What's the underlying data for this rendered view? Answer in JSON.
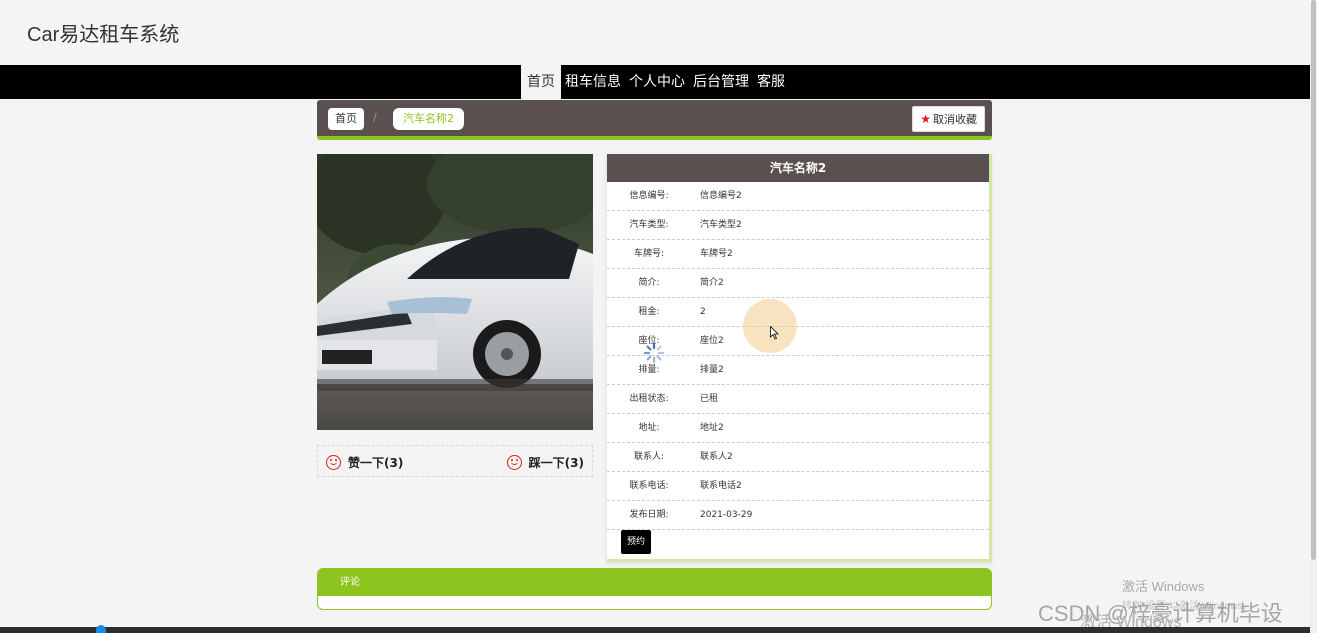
{
  "header": {
    "title": "Car易达租车系统"
  },
  "nav": {
    "items": [
      "首页",
      "租车信息",
      "个人中心",
      "后台管理",
      "客服"
    ]
  },
  "breadcrumb": {
    "home": "首页",
    "separator": "/",
    "current": "汽车名称2"
  },
  "favorite": {
    "label": "取消收藏"
  },
  "votes": {
    "like": "赞一下(3)",
    "dislike": "踩一下(3)"
  },
  "detail": {
    "title": "汽车名称2",
    "rows": [
      {
        "label": "信息编号:",
        "value": "信息编号2"
      },
      {
        "label": "汽车类型:",
        "value": "汽车类型2"
      },
      {
        "label": "车牌号:",
        "value": "车牌号2"
      },
      {
        "label": "简介:",
        "value": "简介2"
      },
      {
        "label": "租金:",
        "value": "2"
      },
      {
        "label": "座位:",
        "value": "座位2"
      },
      {
        "label": "排量:",
        "value": "排量2"
      },
      {
        "label": "出租状态:",
        "value": "已租"
      },
      {
        "label": "地址:",
        "value": "地址2"
      },
      {
        "label": "联系人:",
        "value": "联系人2"
      },
      {
        "label": "联系电话:",
        "value": "联系电话2"
      },
      {
        "label": "发布日期:",
        "value": "2021-03-29"
      }
    ],
    "book_label": "预约"
  },
  "comments": {
    "title": "评论"
  },
  "watermarks": {
    "windows": "激活 Windows",
    "windows_sub": "转到\"设置\"以激活 Windows。",
    "csdn": "CSDN @梓豪计算机毕设",
    "windows2": "激活 Windows"
  },
  "colors": {
    "accent": "#8ec41f",
    "panel_header": "#5b5050",
    "nav_bg": "#000000"
  }
}
